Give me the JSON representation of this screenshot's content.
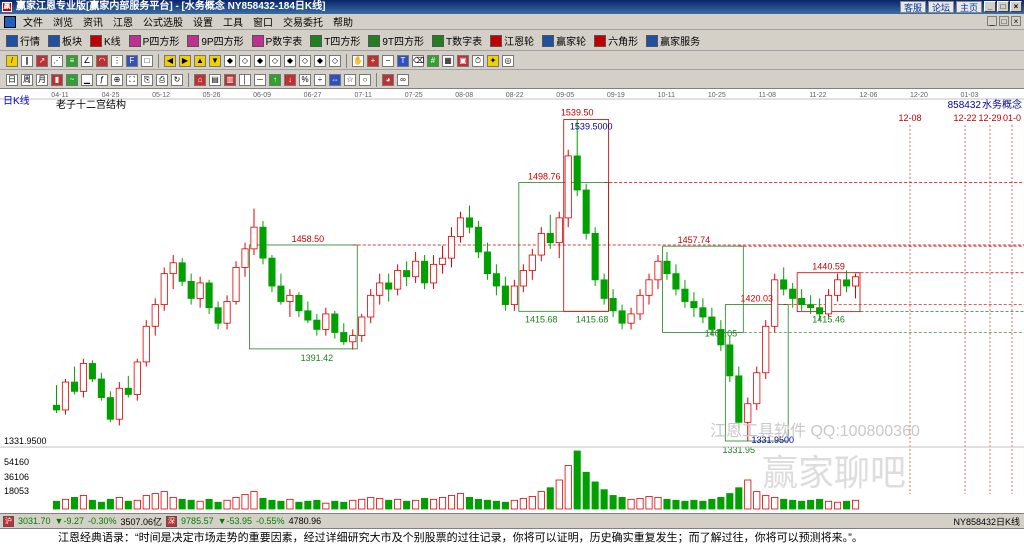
{
  "window": {
    "title": "赢家江恩专业版[赢家内部服务平台] - [水务概念  NY858432-184日K线]",
    "links": [
      "客服",
      "论坛",
      "主页"
    ],
    "buttons": [
      "_",
      "□",
      "×"
    ]
  },
  "menu": {
    "items": [
      "文件",
      "浏览",
      "资讯",
      "江恩",
      "公式选股",
      "设置",
      "工具",
      "窗口",
      "交易委托",
      "帮助"
    ]
  },
  "toolbar1": {
    "items": [
      {
        "label": "行情",
        "icon": "quote-table-icon",
        "color": "#2050a0"
      },
      {
        "label": "板块",
        "icon": "sector-icon",
        "color": "#2050a0"
      },
      {
        "label": "K线",
        "icon": "candlestick-icon",
        "color": "#c00000"
      },
      {
        "label": "P四方形",
        "icon": "p-square-icon",
        "color": "#c03090"
      },
      {
        "label": "9P四方形",
        "icon": "9p-square-icon",
        "color": "#c03090"
      },
      {
        "label": "P数字表",
        "icon": "p-number-table-icon",
        "color": "#c03090"
      },
      {
        "label": "T四方形",
        "icon": "t-square-icon",
        "color": "#208020"
      },
      {
        "label": "9T四方形",
        "icon": "9t-square-icon",
        "color": "#208020"
      },
      {
        "label": "T数字表",
        "icon": "t-number-table-icon",
        "color": "#208020"
      },
      {
        "label": "江恩轮",
        "icon": "gann-wheel-icon",
        "color": "#c00000"
      },
      {
        "label": "赢家轮",
        "icon": "winner-wheel-icon",
        "color": "#2050a0"
      },
      {
        "label": "六角形",
        "icon": "hexagon-icon",
        "color": "#c00000"
      },
      {
        "label": "赢家服务",
        "icon": "service-icon",
        "color": "#2050a0"
      }
    ]
  },
  "chart_header": {
    "period": "日K线",
    "indicator": "老子十二宫结构",
    "symbol": "858432",
    "name": "水务概念"
  },
  "chart_data": {
    "type": "candlestick",
    "ylim": [
      1331.95,
      1545
    ],
    "x_ticks": [
      "04-11",
      "04-25",
      "05-12",
      "05-26",
      "06-09",
      "06-27",
      "07-11",
      "07-25",
      "08-08",
      "08-22",
      "09-05",
      "09-19",
      "10-11",
      "10-25",
      "11-08",
      "11-22",
      "12-06",
      "12-20",
      "01-03"
    ],
    "price_labels": [
      {
        "text": "1539.50",
        "value": 1539.5
      },
      {
        "text": "1539.5000",
        "value": 1539.5
      },
      {
        "text": "1498.76",
        "value": 1498.76
      },
      {
        "text": "1458.50",
        "value": 1458.5
      },
      {
        "text": "1457.74",
        "value": 1457.74
      },
      {
        "text": "1440.59",
        "value": 1440.59
      },
      {
        "text": "1420.03",
        "value": 1420.03
      },
      {
        "text": "1415.68",
        "value": 1415.68
      },
      {
        "text": "1415.68",
        "value": 1415.68
      },
      {
        "text": "1415.46",
        "value": 1415.46
      },
      {
        "text": "1402.05",
        "value": 1402.05
      },
      {
        "text": "1391.42",
        "value": 1391.42
      },
      {
        "text": "1331.9500",
        "value": 1331.95
      },
      {
        "text": "1331.95",
        "value": 1331.95
      }
    ],
    "y_axis_label": "1331.9500",
    "future_dates": [
      "12-08",
      "12-22",
      "12-29",
      "01-0"
    ],
    "volume_ticks": [
      "54160",
      "36106",
      "18053"
    ],
    "candles": [
      [
        1355,
        1368,
        1350,
        1352
      ],
      [
        1352,
        1372,
        1349,
        1370
      ],
      [
        1370,
        1380,
        1362,
        1364
      ],
      [
        1364,
        1385,
        1360,
        1382
      ],
      [
        1382,
        1384,
        1370,
        1372
      ],
      [
        1372,
        1376,
        1358,
        1360
      ],
      [
        1360,
        1364,
        1344,
        1346
      ],
      [
        1346,
        1370,
        1342,
        1366
      ],
      [
        1366,
        1374,
        1360,
        1362
      ],
      [
        1362,
        1385,
        1358,
        1383
      ],
      [
        1383,
        1410,
        1380,
        1406
      ],
      [
        1406,
        1424,
        1400,
        1420
      ],
      [
        1420,
        1444,
        1416,
        1440
      ],
      [
        1440,
        1452,
        1430,
        1447
      ],
      [
        1447,
        1450,
        1432,
        1435
      ],
      [
        1435,
        1440,
        1420,
        1424
      ],
      [
        1424,
        1438,
        1418,
        1434
      ],
      [
        1434,
        1436,
        1414,
        1418
      ],
      [
        1418,
        1422,
        1404,
        1408
      ],
      [
        1408,
        1426,
        1404,
        1422
      ],
      [
        1422,
        1448,
        1420,
        1444
      ],
      [
        1444,
        1460,
        1438,
        1456
      ],
      [
        1456,
        1482,
        1452,
        1470
      ],
      [
        1470,
        1474,
        1446,
        1450
      ],
      [
        1450,
        1452,
        1428,
        1432
      ],
      [
        1432,
        1440,
        1420,
        1422
      ],
      [
        1422,
        1430,
        1412,
        1426
      ],
      [
        1426,
        1428,
        1412,
        1416
      ],
      [
        1416,
        1422,
        1408,
        1410
      ],
      [
        1410,
        1414,
        1400,
        1404
      ],
      [
        1404,
        1418,
        1400,
        1414
      ],
      [
        1414,
        1416,
        1398,
        1402
      ],
      [
        1402,
        1408,
        1394,
        1396
      ],
      [
        1396,
        1404,
        1391,
        1400
      ],
      [
        1400,
        1414,
        1396,
        1412
      ],
      [
        1412,
        1430,
        1408,
        1426
      ],
      [
        1426,
        1440,
        1420,
        1434
      ],
      [
        1434,
        1440,
        1422,
        1430
      ],
      [
        1430,
        1446,
        1426,
        1442
      ],
      [
        1442,
        1448,
        1432,
        1438
      ],
      [
        1438,
        1454,
        1434,
        1448
      ],
      [
        1448,
        1452,
        1430,
        1434
      ],
      [
        1434,
        1452,
        1430,
        1446
      ],
      [
        1446,
        1458,
        1440,
        1450
      ],
      [
        1450,
        1470,
        1444,
        1464
      ],
      [
        1464,
        1480,
        1460,
        1476
      ],
      [
        1476,
        1484,
        1466,
        1470
      ],
      [
        1470,
        1474,
        1450,
        1454
      ],
      [
        1454,
        1460,
        1436,
        1440
      ],
      [
        1440,
        1446,
        1426,
        1432
      ],
      [
        1432,
        1438,
        1416,
        1420
      ],
      [
        1420,
        1436,
        1416,
        1432
      ],
      [
        1432,
        1446,
        1428,
        1442
      ],
      [
        1442,
        1456,
        1436,
        1452
      ],
      [
        1452,
        1470,
        1448,
        1466
      ],
      [
        1466,
        1478,
        1456,
        1460
      ],
      [
        1460,
        1480,
        1450,
        1476
      ],
      [
        1476,
        1520,
        1470,
        1516
      ],
      [
        1516,
        1539.5,
        1490,
        1494
      ],
      [
        1494,
        1498,
        1462,
        1466
      ],
      [
        1466,
        1470,
        1432,
        1436
      ],
      [
        1436,
        1440,
        1420,
        1424
      ],
      [
        1424,
        1430,
        1412,
        1416
      ],
      [
        1416,
        1420,
        1404,
        1408
      ],
      [
        1408,
        1418,
        1404,
        1414
      ],
      [
        1414,
        1430,
        1410,
        1426
      ],
      [
        1426,
        1440,
        1420,
        1436
      ],
      [
        1436,
        1452,
        1430,
        1448
      ],
      [
        1448,
        1454,
        1436,
        1440
      ],
      [
        1440,
        1446,
        1426,
        1430
      ],
      [
        1430,
        1436,
        1418,
        1422
      ],
      [
        1422,
        1428,
        1412,
        1418
      ],
      [
        1418,
        1424,
        1408,
        1412
      ],
      [
        1412,
        1418,
        1400,
        1404
      ],
      [
        1404,
        1410,
        1390,
        1394
      ],
      [
        1394,
        1400,
        1370,
        1374
      ],
      [
        1374,
        1380,
        1340,
        1344
      ],
      [
        1344,
        1360,
        1331.95,
        1356
      ],
      [
        1356,
        1380,
        1352,
        1376
      ],
      [
        1376,
        1410,
        1372,
        1406
      ],
      [
        1406,
        1440,
        1402,
        1436
      ],
      [
        1436,
        1444,
        1426,
        1430
      ],
      [
        1430,
        1434,
        1418,
        1424
      ],
      [
        1424,
        1430,
        1416,
        1420
      ],
      [
        1420,
        1426,
        1414,
        1418
      ],
      [
        1418,
        1424,
        1410,
        1414
      ],
      [
        1414,
        1430,
        1412,
        1426
      ],
      [
        1426,
        1440,
        1422,
        1436
      ],
      [
        1436,
        1442,
        1428,
        1432
      ],
      [
        1432,
        1440,
        1424,
        1438
      ]
    ],
    "volumes": [
      8,
      10,
      12,
      14,
      9,
      7,
      10,
      12,
      8,
      9,
      14,
      16,
      18,
      12,
      10,
      9,
      8,
      10,
      7,
      9,
      12,
      15,
      18,
      11,
      9,
      8,
      10,
      7,
      8,
      9,
      6,
      8,
      7,
      9,
      10,
      12,
      11,
      9,
      10,
      8,
      9,
      11,
      10,
      12,
      14,
      16,
      12,
      10,
      9,
      8,
      7,
      9,
      11,
      13,
      18,
      22,
      30,
      45,
      60,
      38,
      28,
      20,
      14,
      12,
      10,
      11,
      13,
      12,
      10,
      9,
      8,
      9,
      8,
      10,
      12,
      16,
      22,
      30,
      18,
      14,
      12,
      10,
      9,
      8,
      9,
      10,
      8,
      7,
      8,
      9
    ],
    "annotations": [
      "江恩工具软件  QQ:100800360",
      "赢家聊吧"
    ]
  },
  "status": {
    "index1": {
      "value": "3031.70",
      "change": "▼-9.27",
      "pct": "-0.30%",
      "amount": "3507.06亿"
    },
    "index2": {
      "value": "9785.57",
      "change": "▼-53.95",
      "pct": "-0.55%",
      "amount": "4780.96"
    },
    "right": "NY858432日K线"
  },
  "quote": "江恩经典语录：“时间是决定市场走势的重要因素，经过详细研究大市及个别股票的过往记录，你将可以证明，历史确实重复发生；而了解过往，你将可以预测将来。”。"
}
